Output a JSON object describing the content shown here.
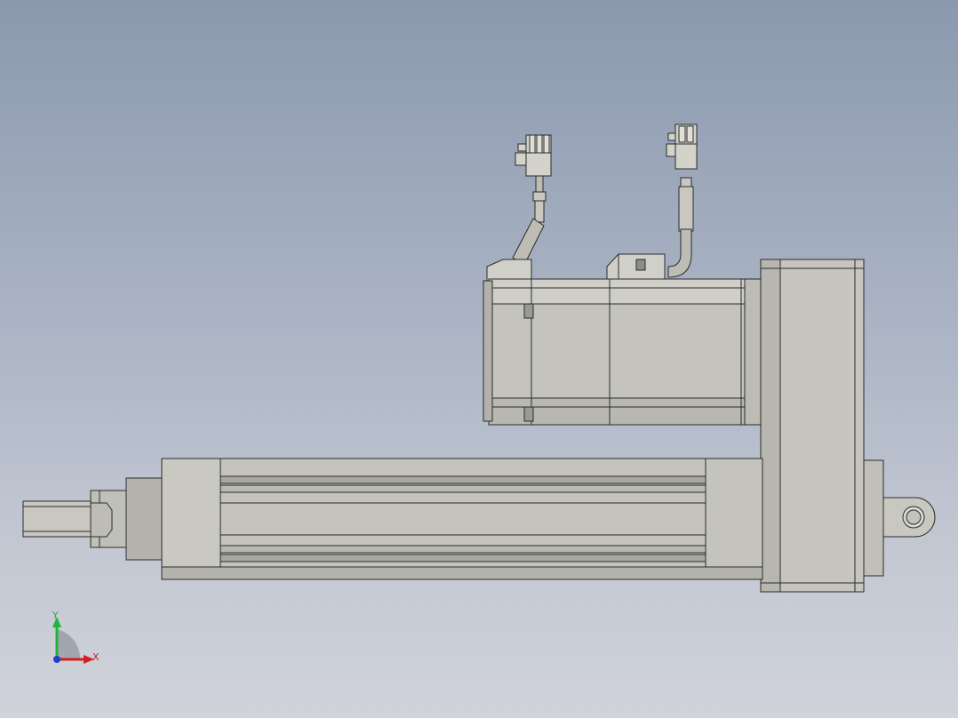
{
  "viewport": {
    "background_top": "#8b98ae",
    "background_bottom": "#d0d3db"
  },
  "model": {
    "description_icon": "linear-actuator-model",
    "body_color": "#c4c4bc",
    "shadow_color": "#a9a9a1",
    "edge_color": "#2b2b2b"
  },
  "triad": {
    "x_label": "X",
    "y_label": "Y",
    "x_color": "#d42020",
    "y_color": "#22b43a",
    "z_color": "#2040c8"
  }
}
